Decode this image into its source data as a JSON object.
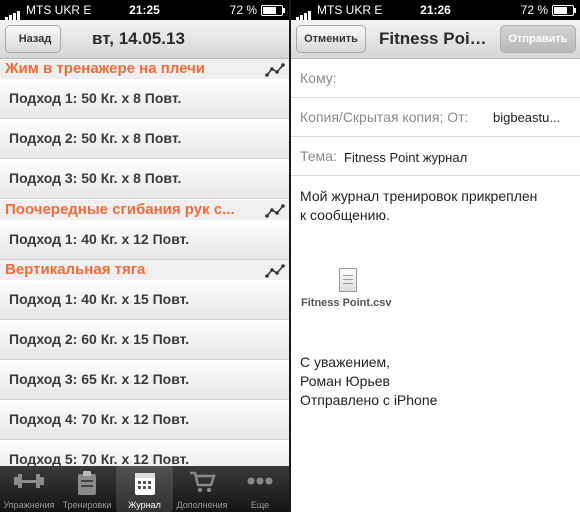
{
  "left": {
    "status": {
      "carrier": "MTS UKR",
      "network": "E",
      "time": "21:25",
      "battery": "72 %",
      "battery_level": 0.72
    },
    "nav": {
      "back_label": "Назад",
      "title": "вт, 14.05.13"
    },
    "sections": [
      {
        "title": "Жим в тренажере на плечи",
        "rows": [
          "Подход  1: 50 Кг. x 8 Повт.",
          "Подход  2: 50 Кг. x 8 Повт.",
          "Подход  3: 50 Кг. x 8 Повт."
        ]
      },
      {
        "title": "Поочередные сгибания рук с...",
        "rows": [
          "Подход  1: 40 Кг. x 12 Повт."
        ]
      },
      {
        "title": "Вертикальная тяга",
        "rows": [
          "Подход  1: 40 Кг. x 15 Повт.",
          "Подход  2: 60 Кг. x 15 Повт.",
          "Подход  3: 65 Кг. x 12 Повт.",
          "Подход  4: 70 Кг. x 12 Повт.",
          "Подход  5: 70 Кг. x 12 Повт."
        ]
      }
    ],
    "tabs": [
      {
        "label": "Упражнения",
        "icon": "dumbbell-icon"
      },
      {
        "label": "Тренировки",
        "icon": "clipboard-icon"
      },
      {
        "label": "Журнал",
        "icon": "calendar-icon",
        "active": true
      },
      {
        "label": "Дополнения",
        "icon": "cart-icon"
      },
      {
        "label": "Еще",
        "icon": "more-icon"
      }
    ]
  },
  "right": {
    "status": {
      "carrier": "MTS UKR",
      "network": "E",
      "time": "21:26",
      "battery": "72 %",
      "battery_level": 0.72
    },
    "nav": {
      "cancel_label": "Отменить",
      "title": "Fitness Poi…",
      "send_label": "Отправить"
    },
    "to_label": "Кому:",
    "cc_label": "Копия/Скрытая копия; От:",
    "from_value": "bigbeastu...",
    "subject_label": "Тема:",
    "subject_value": "Fitness Point журнал",
    "body_lines": [
      "Мой журнал тренировок прикреплен",
      "к сообщению."
    ],
    "attachment_name": "Fitness Point.csv",
    "signature_lines": [
      "С уважением,",
      "Роман Юрьев",
      "Отправлено с iPhone"
    ]
  },
  "colors": {
    "section_header": "#f26b3a",
    "status_bar": "#000000",
    "tabbar": "#1e1e1e"
  }
}
